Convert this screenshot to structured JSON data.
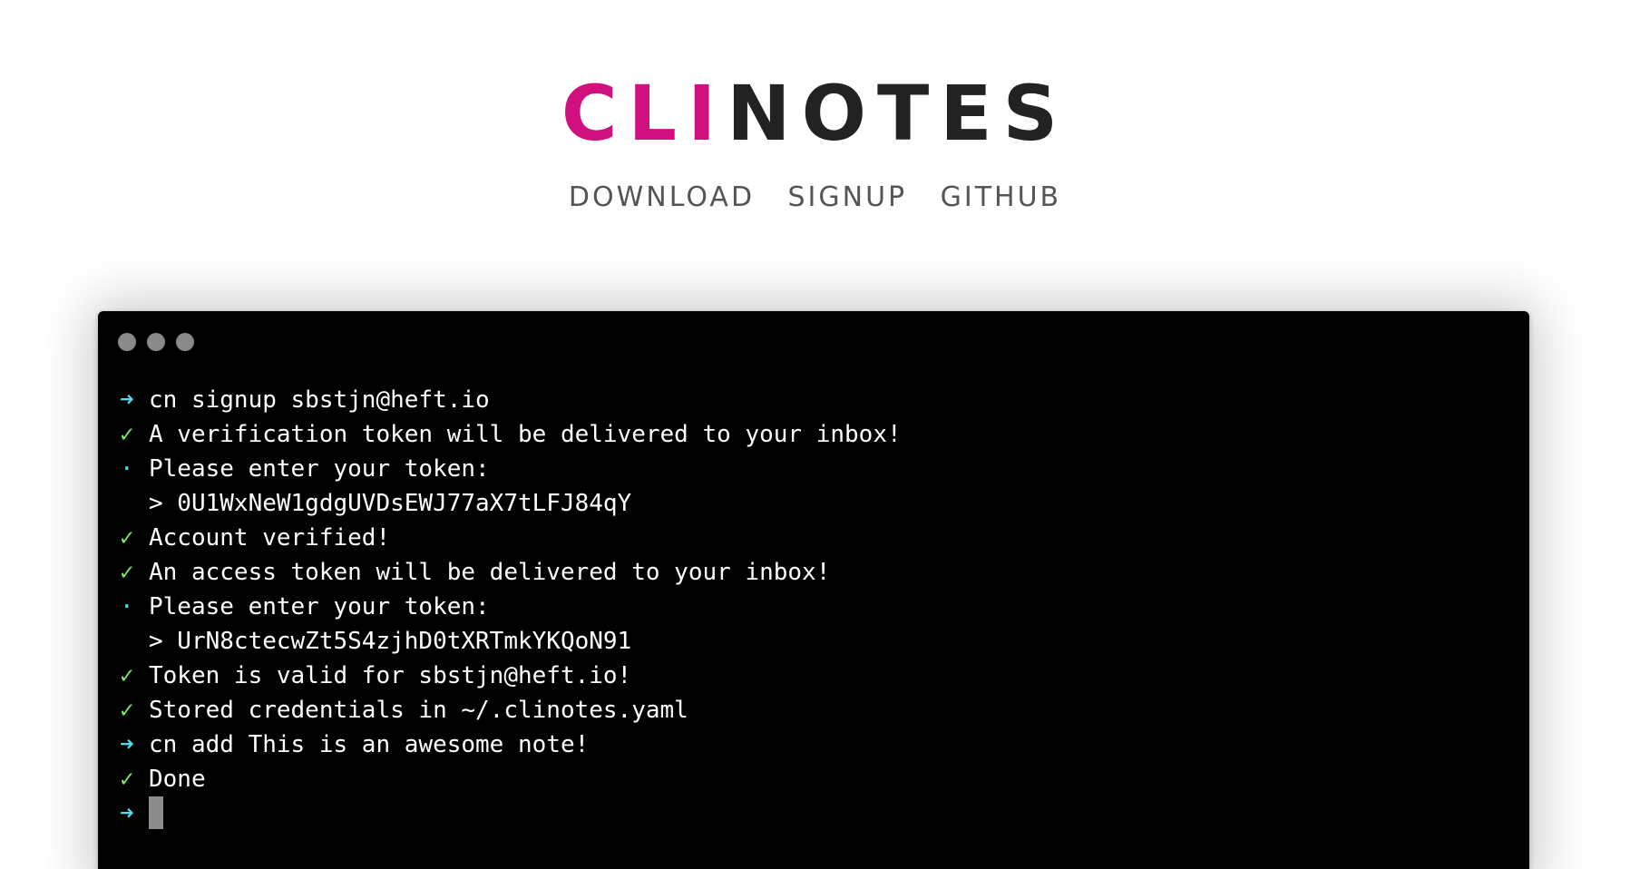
{
  "logo": {
    "part1": "CLI",
    "part2": "NOTES",
    "colors": {
      "part1": "#d0107e",
      "part2": "#222222"
    }
  },
  "nav": {
    "download": "DOWNLOAD",
    "signup": "SIGNUP",
    "github": "GITHUB"
  },
  "terminal": {
    "symbols": {
      "prompt": "➜",
      "ok": "✓",
      "info": "·",
      "continuation": ""
    },
    "lines": [
      {
        "type": "prompt",
        "text": "cn signup sbstjn@heft.io"
      },
      {
        "type": "ok",
        "text": "A verification token will be delivered to your inbox!"
      },
      {
        "type": "info",
        "text": "Please enter your token:"
      },
      {
        "type": "continuation",
        "text": "> 0U1WxNeW1gdgUVDsEWJ77aX7tLFJ84qY"
      },
      {
        "type": "ok",
        "text": "Account verified!"
      },
      {
        "type": "ok",
        "text": "An access token will be delivered to your inbox!"
      },
      {
        "type": "info",
        "text": "Please enter your token:"
      },
      {
        "type": "continuation",
        "text": "> UrN8ctecwZt5S4zjhD0tXRTmkYKQoN91"
      },
      {
        "type": "ok",
        "text": "Token is valid for sbstjn@heft.io!"
      },
      {
        "type": "ok",
        "text": "Stored credentials in ~/.clinotes.yaml"
      },
      {
        "type": "prompt",
        "text": "cn add This is an awesome note!"
      },
      {
        "type": "ok",
        "text": "Done"
      },
      {
        "type": "prompt",
        "text": ""
      }
    ]
  },
  "colors": {
    "accent": "#d0107e",
    "prompt_symbol": "#4fd6e8",
    "ok_symbol": "#7fe06a",
    "terminal_bg": "#000000"
  }
}
